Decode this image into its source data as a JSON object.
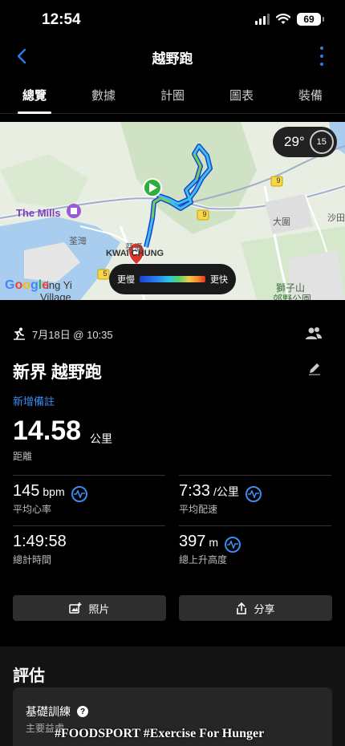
{
  "status": {
    "time": "12:54",
    "battery": "69"
  },
  "header": {
    "title": "越野跑"
  },
  "tabs": [
    "總覽",
    "數據",
    "計圈",
    "圖表",
    "裝備"
  ],
  "map": {
    "weather_temp": "29°",
    "wind_speed": "15",
    "pace_slow": "更慢",
    "pace_fast": "更快",
    "labels": {
      "mills": "The Mills",
      "kwai_chung": "KWAI CHUNG",
      "kwai_chung_cn": "葵涌",
      "tsuen_wan": "荃灣",
      "tai_wai": "大圍",
      "sha_tin": "沙田",
      "lion_rock": "獅子山",
      "lion_rock_park": "郊野公園",
      "tsing_yi": "ing Yi",
      "village": "Village",
      "route_9a": "9",
      "route_9b": "9",
      "route_5": "5",
      "google": "Google"
    }
  },
  "activity": {
    "date": "7月18日 @ 10:35",
    "title": "新界 越野跑",
    "add_note": "新增備註",
    "distance": "14.58",
    "distance_unit": "公里",
    "distance_label": "距離"
  },
  "metrics": {
    "avg_hr": {
      "value": "145",
      "unit": "bpm",
      "label": "平均心率"
    },
    "avg_pace": {
      "value": "7:33",
      "unit": "/公里",
      "label": "平均配速"
    },
    "total_time": {
      "value": "1:49:58",
      "unit": "",
      "label": "總計時間"
    },
    "ascent": {
      "value": "397",
      "unit": "m",
      "label": "總上升高度"
    }
  },
  "actions": {
    "photos": "照片",
    "share": "分享"
  },
  "assessment": {
    "title": "評估",
    "card_title": "基礎訓練",
    "card_help": "?",
    "card_sub": "主要益處"
  },
  "watermark": "#FOODSPORT #Exercise For Hunger",
  "colors": {
    "accent": "#3b8cf0",
    "route_start": "#2fae3c",
    "route_end": "#e0342a"
  }
}
